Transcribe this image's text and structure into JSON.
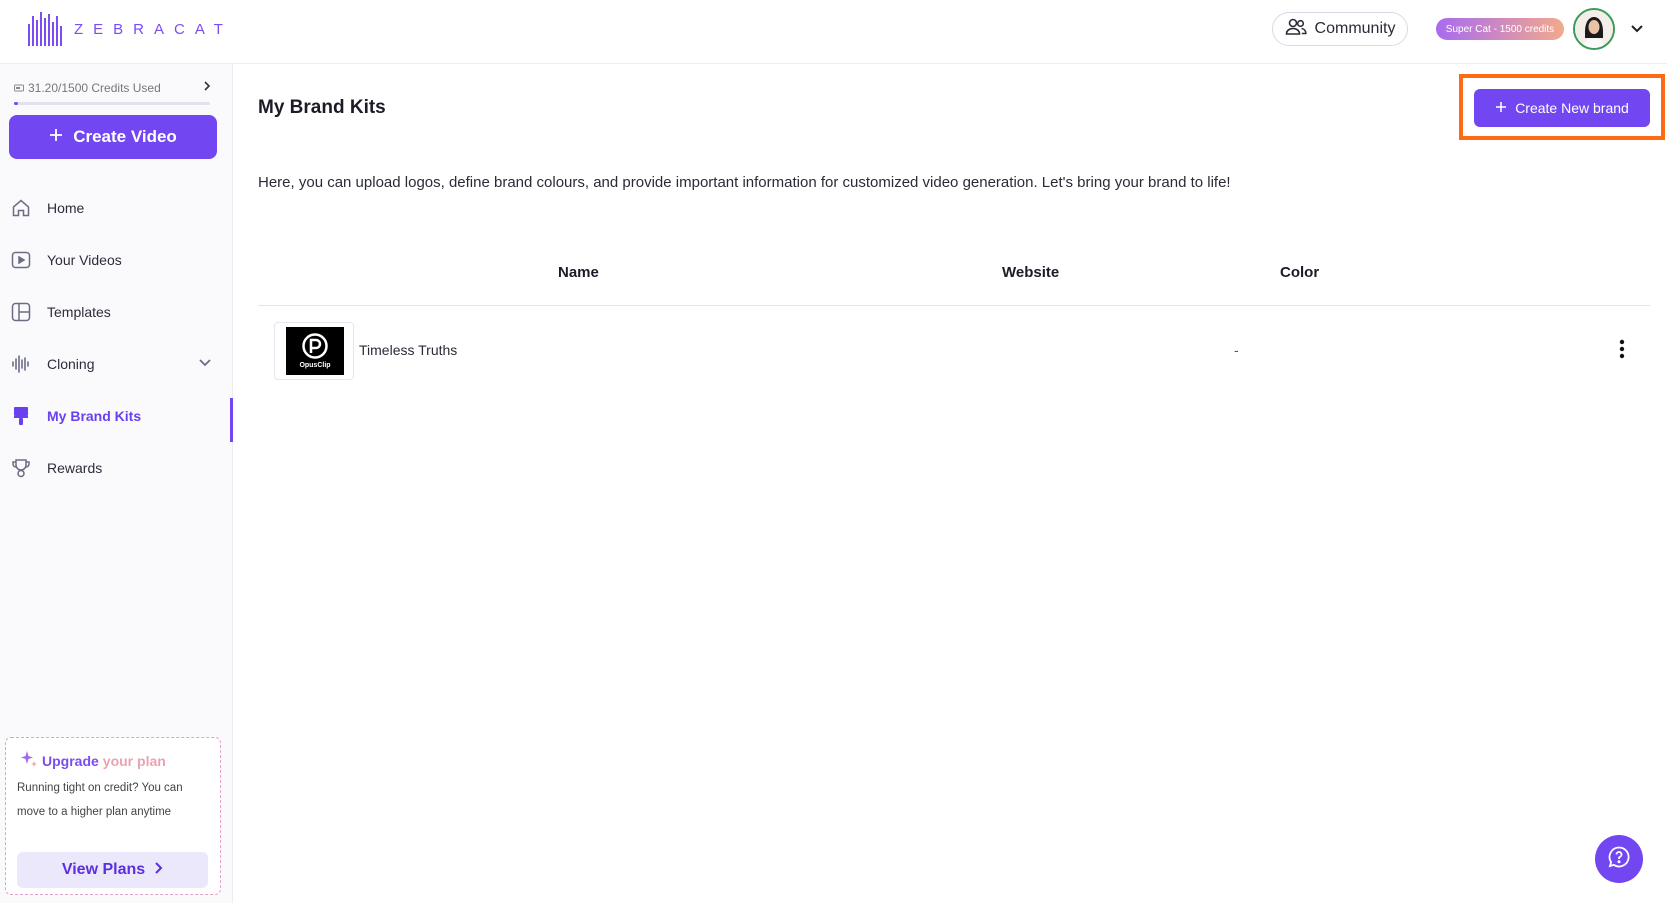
{
  "header": {
    "logo_text": "ZEBRACAT",
    "community_label": "Community",
    "plan_badge": "Super Cat - 1500 credits"
  },
  "sidebar": {
    "credits_text": "31.20/1500 Credits Used",
    "credits_used_fraction": 0.021,
    "create_video_label": "Create Video",
    "items": [
      {
        "label": "Home",
        "icon": "home-icon"
      },
      {
        "label": "Your Videos",
        "icon": "play-icon"
      },
      {
        "label": "Templates",
        "icon": "layout-icon"
      },
      {
        "label": "Cloning",
        "icon": "waveform-icon"
      },
      {
        "label": "My Brand Kits",
        "icon": "paint-brush-icon"
      },
      {
        "label": "Rewards",
        "icon": "trophy-icon"
      }
    ],
    "upgrade": {
      "title_part1": "Upgrade",
      "title_part2": "your plan",
      "description": "Running tight on credit? You can move to a higher plan anytime",
      "button_label": "View Plans"
    }
  },
  "main": {
    "title": "My Brand Kits",
    "create_brand_label": "Create New brand",
    "description": "Here, you can upload logos, define brand colours, and provide important information for customized video generation. Let's bring your brand to life!",
    "columns": [
      "Name",
      "Website",
      "Color"
    ],
    "rows": [
      {
        "name": "Timeless Truths",
        "logo_text": "OpusClip",
        "website": "-"
      }
    ]
  },
  "colors": {
    "accent": "#7246f0",
    "highlight": "#ff6a14"
  }
}
